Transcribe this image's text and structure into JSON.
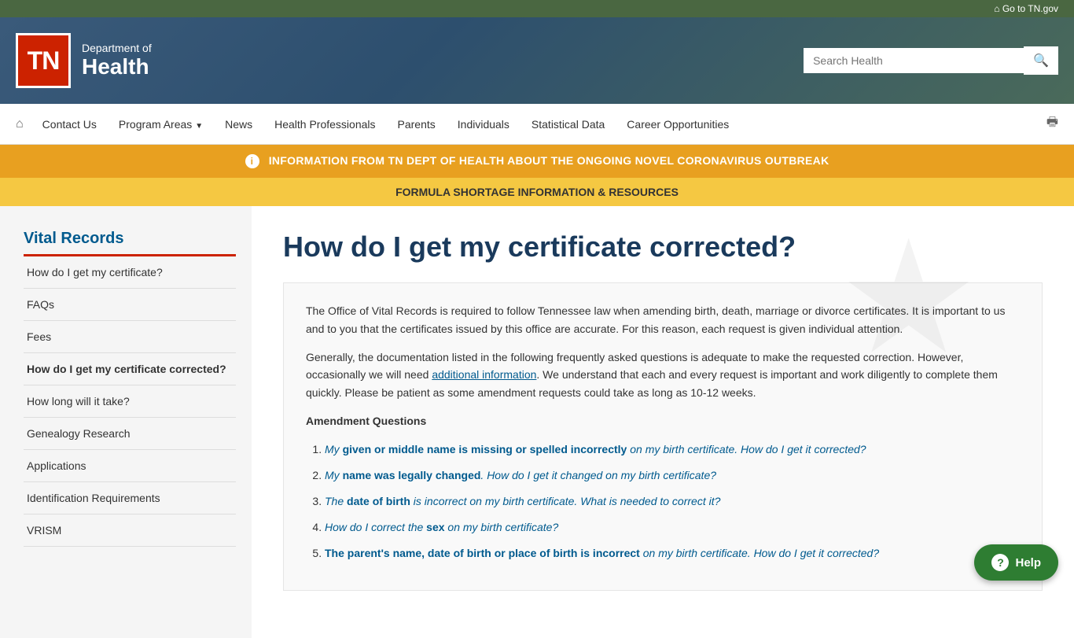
{
  "topBar": {
    "link": "Go to TN.gov"
  },
  "header": {
    "logo": "TN",
    "deptOf": "Department of",
    "health": "Health",
    "search": {
      "placeholder": "Search Health",
      "label": "Search Health"
    }
  },
  "nav": {
    "home": "⌂",
    "items": [
      {
        "label": "Contact Us",
        "arrow": false
      },
      {
        "label": "Program Areas",
        "arrow": true
      },
      {
        "label": "News",
        "arrow": false
      },
      {
        "label": "Health Professionals",
        "arrow": false
      },
      {
        "label": "Parents",
        "arrow": false
      },
      {
        "label": "Individuals",
        "arrow": false
      },
      {
        "label": "Statistical Data",
        "arrow": false
      },
      {
        "label": "Career Opportunities",
        "arrow": false
      }
    ]
  },
  "alerts": {
    "orange": "INFORMATION FROM TN DEPT OF HEALTH ABOUT THE ONGOING NOVEL CORONAVIRUS OUTBREAK",
    "yellow": "FORMULA SHORTAGE INFORMATION & RESOURCES"
  },
  "sidebar": {
    "title": "Vital Records",
    "items": [
      {
        "label": "How do I get my certificate?",
        "active": false
      },
      {
        "label": "FAQs",
        "active": false
      },
      {
        "label": "Fees",
        "active": false
      },
      {
        "label": "How do I get my certificate corrected?",
        "active": true
      },
      {
        "label": "How long will it take?",
        "active": false
      },
      {
        "label": "Genealogy Research",
        "active": false
      },
      {
        "label": "Applications",
        "active": false
      },
      {
        "label": "Identification Requirements",
        "active": false
      },
      {
        "label": "VRISM",
        "active": false
      }
    ]
  },
  "pageTitle": "How do I get my certificate corrected?",
  "content": {
    "intro1": "The Office of Vital Records is required to follow Tennessee law when amending birth, death, marriage or divorce certificates. It is important to us and to you that the certificates issued by this office are accurate.  For this reason, each request is given individual attention.",
    "intro2part1": "Generally, the documentation listed in the following frequently asked questions is adequate to make the requested correction. However, occasionally we will need ",
    "intro2link": "additional information",
    "intro2part2": ".  We understand that each and every request is important and work diligently to complete them quickly.  Please be patient as some amendment requests could take as long as 10-12 weeks.",
    "amendmentTitle": "Amendment Questions",
    "faqs": [
      {
        "text1": "My ",
        "bold": "given or middle name is missing or spelled incorrectly",
        "text2": " on my birth certificate.  How do I get it corrected?"
      },
      {
        "text1": "My ",
        "bold": "name was legally changed",
        "text2": ". How do I get it changed on my birth certificate?"
      },
      {
        "text1": "The ",
        "bold": "date of birth",
        "text2": " is incorrect on my birth certificate.  What is needed to correct it?"
      },
      {
        "text1": "How do I correct the ",
        "bold": "sex",
        "text2": " on my birth certificate?"
      },
      {
        "text1": "The parent's name, date of birth or place of birth is incorrect",
        "text2": " on my birth certificate.  How do I get it corrected?"
      }
    ]
  },
  "helpButton": "Help"
}
